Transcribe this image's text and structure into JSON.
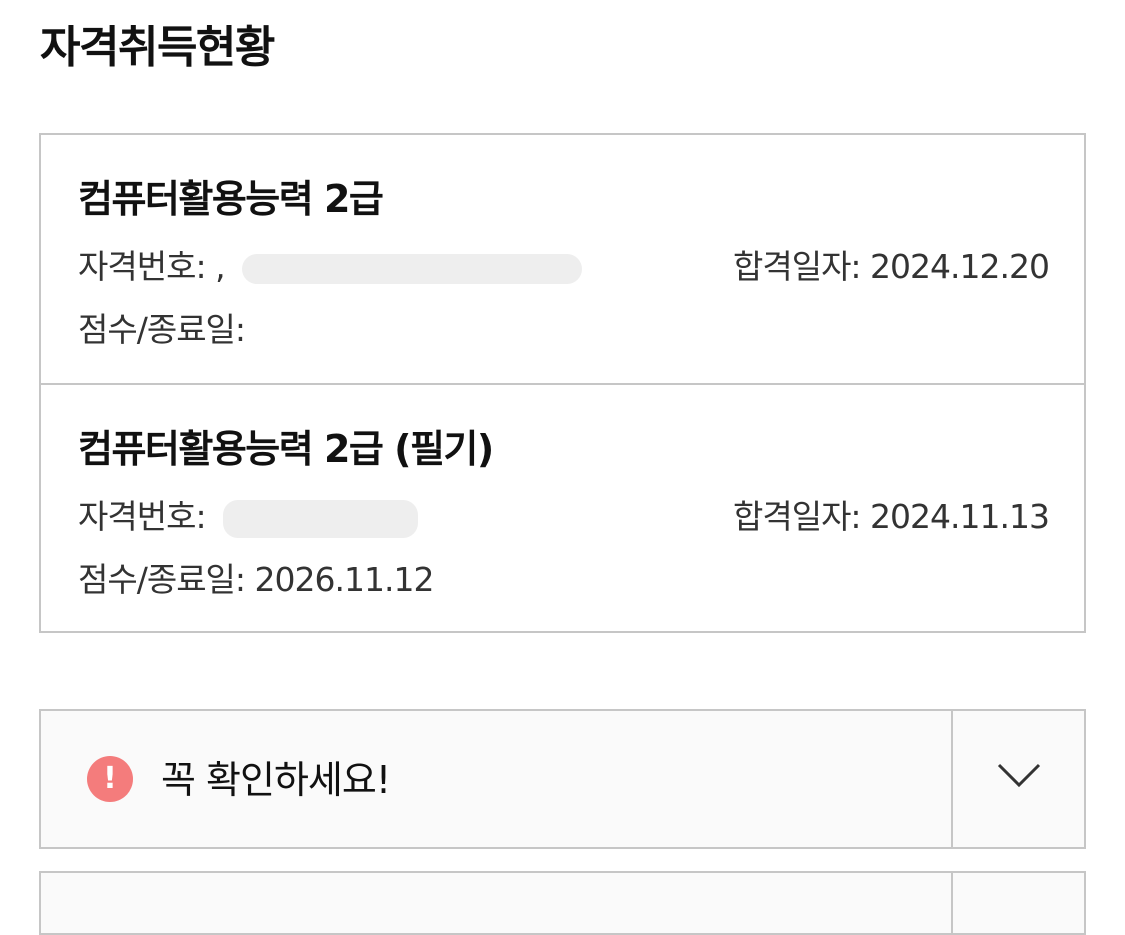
{
  "page": {
    "title": "자격취득현황"
  },
  "certifications": [
    {
      "name": "컴퓨터활용능력 2급",
      "license_label": "자격번호:",
      "license_prefix": ",",
      "pass_date_label": "합격일자:",
      "pass_date": "2024.12.20",
      "score_label": "점수/종료일:",
      "score_value": ""
    },
    {
      "name": "컴퓨터활용능력 2급 (필기)",
      "license_label": "자격번호:",
      "license_prefix": "",
      "pass_date_label": "합격일자:",
      "pass_date": "2024.11.13",
      "score_label": "점수/종료일:",
      "score_value": "2026.11.12"
    }
  ],
  "notice": {
    "icon": "exclamation-icon",
    "icon_glyph": "!",
    "label": "꼭 확인하세요!",
    "accent_color": "#f47c7c"
  },
  "colors": {
    "border": "#c6c6c6",
    "text": "#111111",
    "secondary_text": "#333333"
  }
}
